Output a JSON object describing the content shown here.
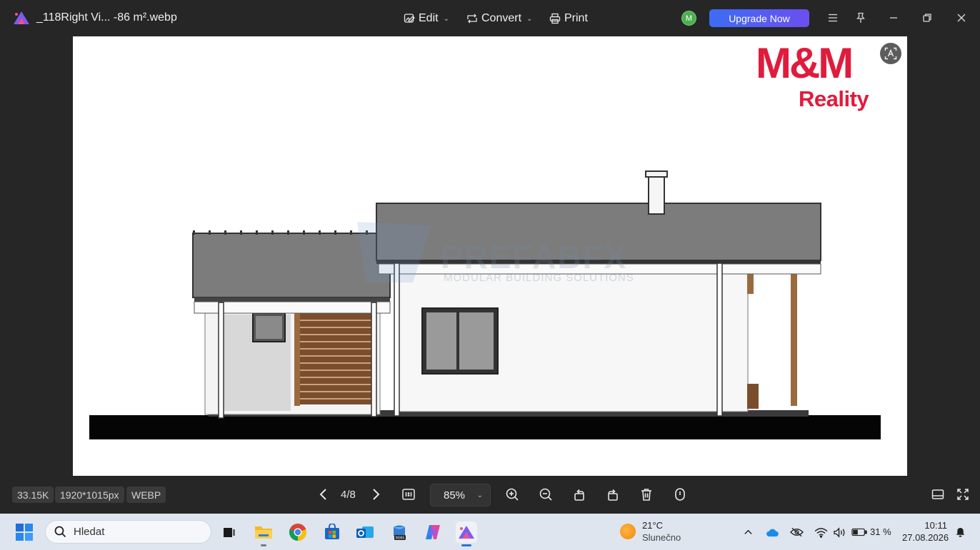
{
  "window": {
    "file_title": "_118Right Vi... -86 m².webp",
    "menus": [
      {
        "label": "Edit",
        "icon": "edit-image-icon"
      },
      {
        "label": "Convert",
        "icon": "convert-icon"
      },
      {
        "label": "Print",
        "icon": "printer-icon"
      }
    ],
    "avatar_letter": "M",
    "upgrade_label": "Upgrade Now",
    "accent_color": "#4f5ff2"
  },
  "image": {
    "brand_name": "M&M",
    "brand_sub": "Reality",
    "brand_color": "#e01b3c",
    "watermark_main": "PREFABFX",
    "watermark_sub": "MODULAR BUILDING SOLUTIONS"
  },
  "bottombar": {
    "file_size": "33.15K",
    "dimensions": "1920*1015px",
    "format": "WEBP",
    "page": "4/8",
    "zoom": "85%",
    "actual_size_label": "1:1"
  },
  "taskbar": {
    "search_placeholder": "Hledat",
    "weather_temp": "21°C",
    "weather_desc": "Slunečno",
    "battery": "31 %",
    "time": "10:11",
    "date": "27.08.2026"
  }
}
